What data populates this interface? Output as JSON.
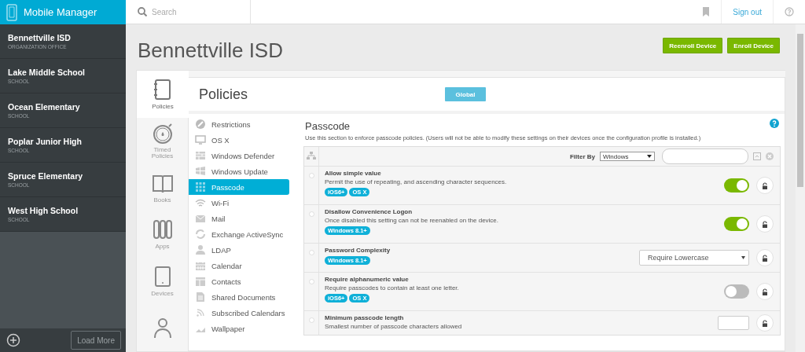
{
  "app": {
    "title": "Mobile Manager"
  },
  "organizations": [
    {
      "name": "Bennettville ISD",
      "type": "ORGANIZATION OFFICE"
    },
    {
      "name": "Lake Middle School",
      "type": "SCHOOL"
    },
    {
      "name": "Ocean Elementary",
      "type": "SCHOOL"
    },
    {
      "name": "Poplar Junior High",
      "type": "SCHOOL"
    },
    {
      "name": "Spruce Elementary",
      "type": "SCHOOL"
    },
    {
      "name": "West High School",
      "type": "SCHOOL"
    }
  ],
  "load_more": "Load More",
  "search": {
    "placeholder": "Search"
  },
  "sign_out": "Sign out",
  "page_title": "Bennettville ISD",
  "actions": [
    "Reenroll Device",
    "Enroll Device"
  ],
  "sections": [
    {
      "kind": "notebook",
      "label": "Policies",
      "selected": true
    },
    {
      "kind": "timer",
      "label": "Timed Policies",
      "selected": false
    },
    {
      "kind": "book",
      "label": "Books",
      "selected": false
    },
    {
      "kind": "apps",
      "label": "Apps",
      "selected": false
    },
    {
      "kind": "tablet",
      "label": "Devices",
      "selected": false
    },
    {
      "kind": "person",
      "selected": false
    }
  ],
  "policies": {
    "title": "Policies",
    "scope": "Global"
  },
  "policy_menu": [
    {
      "kind": "ban",
      "label": "Restrictions",
      "selected": false
    },
    {
      "kind": "monitor",
      "label": "OS X",
      "selected": false
    },
    {
      "kind": "wall",
      "label": "Windows Defender",
      "selected": false
    },
    {
      "kind": "windows",
      "label": "Windows Update",
      "selected": false
    },
    {
      "kind": "keypad",
      "label": "Passcode",
      "selected": true
    },
    {
      "kind": "wifi",
      "label": "Wi-Fi",
      "selected": false
    },
    {
      "kind": "mail",
      "label": "Mail",
      "selected": false
    },
    {
      "kind": "sync",
      "label": "Exchange ActiveSync",
      "selected": false
    },
    {
      "kind": "person",
      "label": "LDAP",
      "selected": false
    },
    {
      "kind": "calendar",
      "label": "Calendar",
      "selected": false
    },
    {
      "kind": "contacts",
      "label": "Contacts",
      "selected": false
    },
    {
      "kind": "document",
      "label": "Shared Documents",
      "selected": false
    },
    {
      "kind": "rss",
      "label": "Subscribed Calendars",
      "selected": false
    },
    {
      "kind": "image",
      "label": "Wallpaper",
      "selected": false
    }
  ],
  "passcode": {
    "title": "Passcode",
    "description": "Use this section to enforce passcode policies. (Users will not be able to modify these settings on their devices once the configuration profile is installed.)",
    "filter_label": "Filter By",
    "filter_value": "Windows",
    "settings": [
      {
        "kind": "toggle",
        "title": "Allow simple value",
        "description": "Permit the use of repeating, and ascending character sequences.",
        "tags": [
          "iOS6+",
          "OS X"
        ],
        "on": true
      },
      {
        "kind": "toggle",
        "title": "Disallow Convenience Logon",
        "description": "Once disabled this setting can not be reenabled on the device.",
        "tags": [
          "Windows 8.1+"
        ],
        "on": true
      },
      {
        "kind": "select",
        "title": "Password Complexity",
        "tags": [
          "Windows 8.1+"
        ],
        "value": "Require Lowercase"
      },
      {
        "kind": "toggle",
        "title": "Require alphanumeric value",
        "description": "Require passcodes to contain at least one letter.",
        "tags": [
          "iOS6+",
          "OS X"
        ],
        "on": false
      },
      {
        "kind": "number",
        "title": "Minimum passcode length",
        "description": "Smallest number of passcode characters allowed"
      }
    ]
  }
}
